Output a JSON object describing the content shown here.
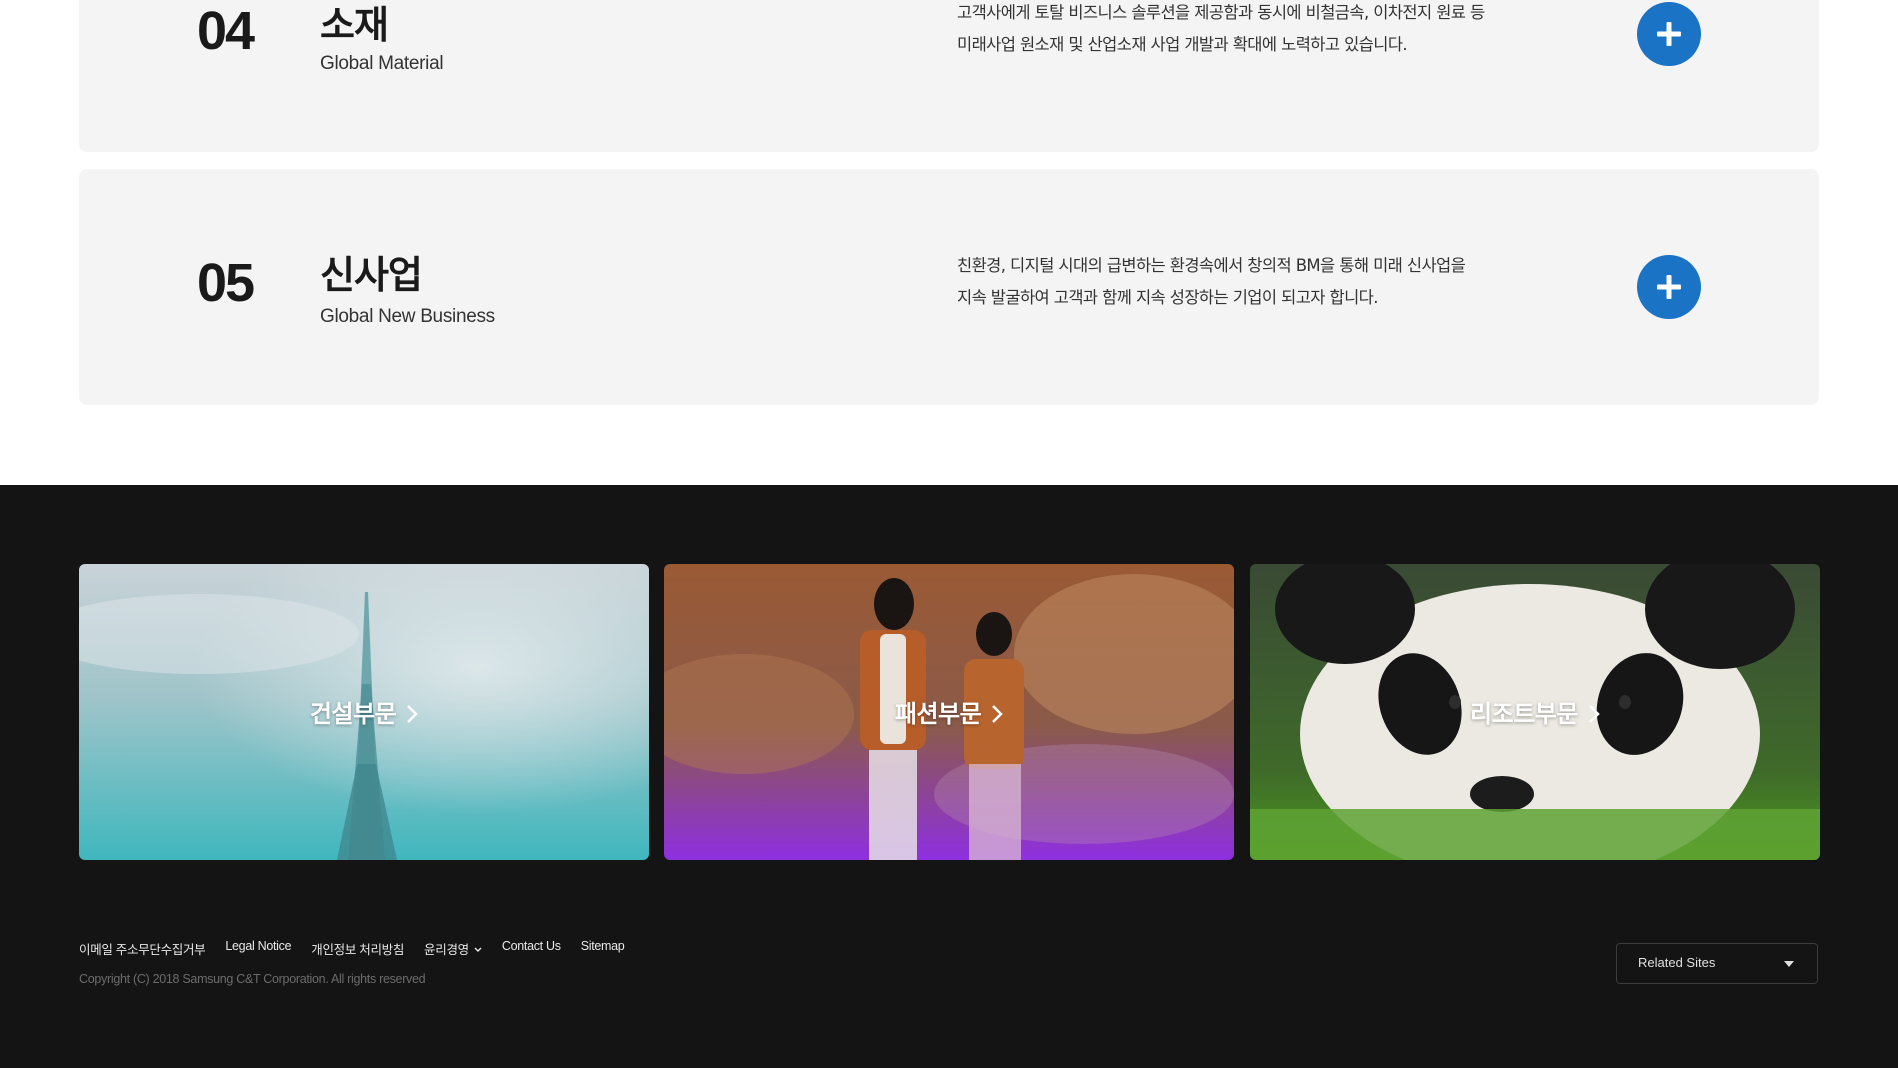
{
  "businesses": [
    {
      "number": "04",
      "title": "소재",
      "subtitle": "Global Material",
      "desc_line1": "고객사에게 토탈 비즈니스 솔루션을 제공함과 동시에 비철금속, 이차전지 원료 등",
      "desc_line2": "미래사업 원소재 및 산업소재 사업 개발과 확대에 노력하고 있습니다.",
      "expand_icon": "plus-icon"
    },
    {
      "number": "05",
      "title": "신사업",
      "subtitle": "Global New Business",
      "desc_line1": "친환경, 디지털 시대의 급변하는 환경속에서 창의적 BM을 통해 미래 신사업을",
      "desc_line2": "지속 발굴하여 고객과 함께 지속 성장하는 기업이 되고자 합니다.",
      "expand_icon": "plus-icon"
    }
  ],
  "divisions": [
    {
      "label": "건설부문",
      "icon": "chevron-right-icon"
    },
    {
      "label": "패션부문",
      "icon": "chevron-right-icon"
    },
    {
      "label": "리조트부문",
      "icon": "chevron-right-icon"
    }
  ],
  "footer": {
    "links": [
      "이메일 주소무단수집거부",
      "Legal Notice",
      "개인정보 처리방침",
      "윤리경영",
      "Contact Us",
      "Sitemap"
    ],
    "copyright": "Copyright (C) 2018 Samsung C&T Corporation. All rights reserved",
    "related_sites": "Related Sites"
  },
  "colors": {
    "accent_blue": "#1a73c4",
    "card_bg": "#f4f4f4",
    "footer_bg": "#141414",
    "construction_tint": "#3fb7bd",
    "fashion_tint": "#8e2fe0",
    "resort_tint": "#4c9a1e"
  }
}
